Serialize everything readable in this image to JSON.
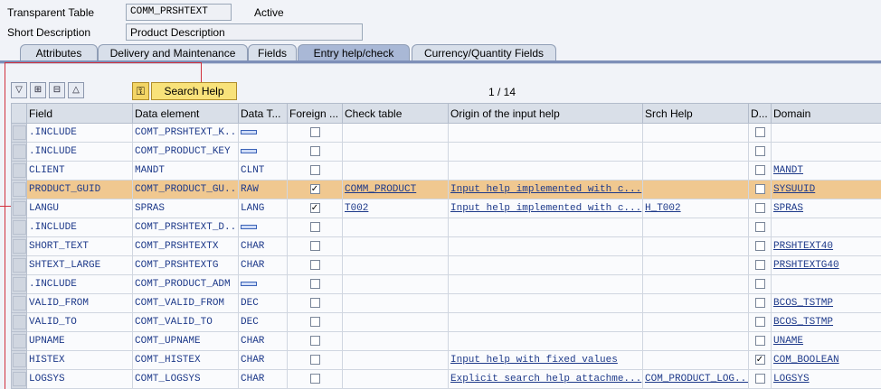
{
  "header": {
    "table_type_label": "Transparent Table",
    "table_name": "COMM_PRSHTEXT",
    "status": "Active",
    "short_desc_label": "Short Description",
    "short_desc_value": "Product Description"
  },
  "tabs": [
    {
      "label": "Attributes",
      "active": false
    },
    {
      "label": "Delivery and Maintenance",
      "active": false
    },
    {
      "label": "Fields",
      "active": false
    },
    {
      "label": "Entry help/check",
      "active": true
    },
    {
      "label": "Currency/Quantity Fields",
      "active": false
    }
  ],
  "toolbar": {
    "search_help_label": "Search Help",
    "icons": [
      "filter-icon",
      "insert-row-icon",
      "delete-row-icon",
      "sort-icon",
      "key-icon"
    ]
  },
  "pager": "1 / 14",
  "columns": [
    "Field",
    "Data element",
    "Data T...",
    "Foreign ...",
    "Check table",
    "Origin of the input help",
    "Srch Help",
    "D...",
    "Domain"
  ],
  "rows": [
    {
      "field": ".INCLUDE",
      "element": "COMT_PRSHTEXT_K...",
      "dtype": "",
      "struct": true,
      "fk": false,
      "check": "",
      "origin": "",
      "srch": "",
      "d": false,
      "domain": ""
    },
    {
      "field": ".INCLUDE",
      "element": "COMT_PRODUCT_KEY",
      "dtype": "",
      "struct": true,
      "fk": false,
      "check": "",
      "origin": "",
      "srch": "",
      "d": false,
      "domain": ""
    },
    {
      "field": "CLIENT",
      "element": "MANDT",
      "dtype": "CLNT",
      "struct": false,
      "fk": false,
      "check": "",
      "origin": "",
      "srch": "",
      "d": false,
      "domain": "MANDT"
    },
    {
      "field": "PRODUCT_GUID",
      "element": "COMT_PRODUCT_GU...",
      "dtype": "RAW",
      "struct": false,
      "fk": true,
      "check": "COMM_PRODUCT",
      "origin": "Input help implemented with c...",
      "srch": "",
      "d": false,
      "domain": "SYSUUID",
      "selected": true
    },
    {
      "field": "LANGU",
      "element": "SPRAS",
      "dtype": "LANG",
      "struct": false,
      "fk": true,
      "check": "T002",
      "origin": "Input help implemented with c...",
      "srch": "H_T002",
      "d": false,
      "domain": "SPRAS"
    },
    {
      "field": ".INCLUDE",
      "element": "COMT_PRSHTEXT_D...",
      "dtype": "",
      "struct": true,
      "fk": false,
      "check": "",
      "origin": "",
      "srch": "",
      "d": false,
      "domain": ""
    },
    {
      "field": "SHORT_TEXT",
      "element": "COMT_PRSHTEXTX",
      "dtype": "CHAR",
      "struct": false,
      "fk": false,
      "check": "",
      "origin": "",
      "srch": "",
      "d": false,
      "domain": "PRSHTEXT40"
    },
    {
      "field": "SHTEXT_LARGE",
      "element": "COMT_PRSHTEXTG",
      "dtype": "CHAR",
      "struct": false,
      "fk": false,
      "check": "",
      "origin": "",
      "srch": "",
      "d": false,
      "domain": "PRSHTEXTG40"
    },
    {
      "field": ".INCLUDE",
      "element": "COMT_PRODUCT_ADM",
      "dtype": "",
      "struct": true,
      "fk": false,
      "check": "",
      "origin": "",
      "srch": "",
      "d": false,
      "domain": ""
    },
    {
      "field": "VALID_FROM",
      "element": "COMT_VALID_FROM",
      "dtype": "DEC",
      "struct": false,
      "fk": false,
      "check": "",
      "origin": "",
      "srch": "",
      "d": false,
      "domain": "BCOS_TSTMP"
    },
    {
      "field": "VALID_TO",
      "element": "COMT_VALID_TO",
      "dtype": "DEC",
      "struct": false,
      "fk": false,
      "check": "",
      "origin": "",
      "srch": "",
      "d": false,
      "domain": "BCOS_TSTMP"
    },
    {
      "field": "UPNAME",
      "element": "COMT_UPNAME",
      "dtype": "CHAR",
      "struct": false,
      "fk": false,
      "check": "",
      "origin": "",
      "srch": "",
      "d": false,
      "domain": "UNAME"
    },
    {
      "field": "HISTEX",
      "element": "COMT_HISTEX",
      "dtype": "CHAR",
      "struct": false,
      "fk": false,
      "check": "",
      "origin": "Input help with fixed values",
      "srch": "",
      "d": true,
      "domain": "COM_BOOLEAN"
    },
    {
      "field": "LOGSYS",
      "element": "COMT_LOGSYS",
      "dtype": "CHAR",
      "struct": false,
      "fk": false,
      "check": "",
      "origin": "Explicit search help attachme...",
      "srch": "COM_PRODUCT_LOG...",
      "d": false,
      "domain": "LOGSYS"
    }
  ]
}
